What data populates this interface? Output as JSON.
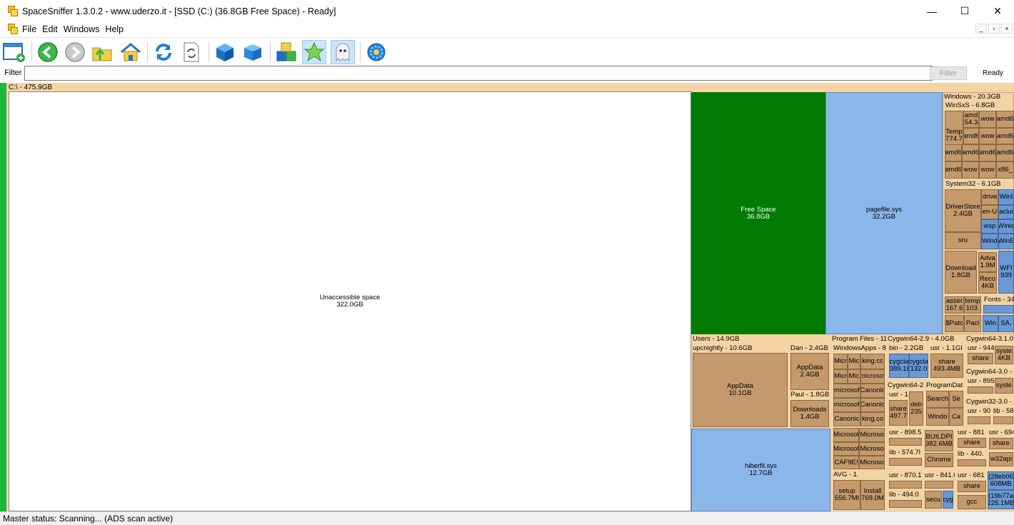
{
  "window": {
    "title": "SpaceSniffer 1.3.0.2 - www.uderzo.it - [SSD (C:) (36.8GB Free Space) - Ready]",
    "minimize": "—",
    "maximize": "☐",
    "close": "✕"
  },
  "menu": {
    "file": "File",
    "edit": "Edit",
    "windows": "Windows",
    "help": "Help",
    "mdi_min": "_",
    "mdi_restore": "▫",
    "mdi_close": "×"
  },
  "toolbar": {
    "icons": [
      "new-scan-icon",
      "back-icon",
      "forward-icon",
      "up-folder-icon",
      "home-icon",
      "refresh-icon",
      "refresh-page-icon",
      "blue-cube-icon",
      "blue-cube-flat-icon",
      "colored-cubes-icon",
      "star-icon",
      "ghost-icon",
      "gear-icon"
    ],
    "colors": {
      "green": "#3cb84a",
      "gray": "#9aa0a6",
      "blue": "#1f7fd6",
      "yellow": "#f0c020"
    }
  },
  "filter": {
    "label": "Filter",
    "value": "",
    "button": "Filter",
    "status": "Ready"
  },
  "treemap": {
    "root_label": "C:\\ - 475.9GB",
    "unaccessible": {
      "name": "Unaccessible space",
      "size": "322.0GB"
    },
    "free_space": {
      "name": "Free Space",
      "size": "36.8GB"
    },
    "pagefile": {
      "name": "pagefile.sys",
      "size": "32.2GB"
    },
    "hiberfil": {
      "name": "hiberfil.sys",
      "size": "12.7GB"
    },
    "windows": {
      "label": "Windows - 20.3GB",
      "winsxs": "WinSxS - 6.8GB",
      "temp": "Temp",
      "temp_size": "774.7",
      "amd1": "amd",
      "amd1_size": "54.3",
      "wow": "wow",
      "amd": "amd6",
      "x86": "x86_",
      "system32": "System32 - 6.1GB",
      "driverstore": "DriverStore",
      "driverstore_size": "2.4GB",
      "drive": "drive",
      "enu": "en-U",
      "wsp": "wsp",
      "wind": "Wind",
      "sru": "sru",
      "winr": "Winl",
      "acl": "aclui",
      "winl2": "Winla",
      "wine": "WinE",
      "download": "Download",
      "download_size": "1.8GB",
      "adva": "Adva",
      "adva_size": "1.9M",
      "reco": "Reco",
      "reco_size": "4KB",
      "wfi": "WFI",
      "wfi_size": "939",
      "asse": "asser",
      "asse_size": "167.6",
      "temp2": "temp",
      "temp2_size": "103.",
      "fonts": "Fonts - 34",
      "patc": "$Patc",
      "pack": "Pacl",
      "win": "Win",
      "sa": "SA."
    },
    "users": {
      "label": "Users - 14.9GB",
      "upcnightly": "upcnightly - 10.6GB",
      "appdata": "AppData",
      "appdata_size": "10.1GB",
      "dan": "Dan - 2.4GB",
      "dan_appdata": "AppData",
      "dan_appdata_size": "2.4GB",
      "paul": "Paul - 1.8GB",
      "downloads": "Downloads",
      "downloads_size": "1.4GB"
    },
    "program_files": {
      "label": "Program Files - 11",
      "windowsapps": "WindowsApps - 8",
      "mic1": "Micr",
      "mic2": "Mic",
      "king1": "king.cc",
      "microsof": "microsof",
      "canoni": "Canonic",
      "canoni2": "Canonic",
      "canoni3": "Canonic",
      "king2": "king.co",
      "microsof2": "Microsof",
      "microso3": "Microso",
      "caf": "CAF9E!",
      "avg": "AVG - 1.",
      "setup": "setup",
      "setup_size": "556.7MI",
      "install": "Install",
      "install_size": "769.0M"
    },
    "cygwin": {
      "cyg29": "Cygwin64-2.9 - 4.0GB",
      "bin": "bin - 2.2GB",
      "cygcla1": "cygcla",
      "cygcla1_size": "389.1I",
      "cygcla2": "cygcla",
      "cygcla2_size": "132.0",
      "usr_11": "usr - 1.1GI",
      "share_493": "share",
      "share_493_size": "493.4MB",
      "cyg2x": "Cygwin64-2",
      "usr_1": "usr - 1",
      "share_497": "share",
      "share_497_size": "497.7",
      "deb": "deb",
      "deb_size": "235",
      "programdat": "ProgramDat",
      "search": "Search",
      "se": "Se",
      "windo": "Windo",
      "ca": "Ca",
      "usr_898": "usr - 898.5",
      "lib_574": "lib - 574.7l",
      "buildp": "BUILDPI",
      "buildp_size": "382.6MB",
      "chrome": "Chrome",
      "usr_870": "usr - 870.1",
      "lib_494": "lib - 494.0",
      "usr_841": "usr - 841.6",
      "secu": "secu",
      "cyg": "cyg",
      "cyg31": "Cygwin64-3.1.0",
      "usr_944": "usr - 944.",
      "syste1": "syste",
      "syste1_size": "4KB",
      "share_1": "share",
      "cyg30": "Cygwin64-3.0 -",
      "usr_895": "usr - 895",
      "syste2": "syste",
      "cyg32": "Cygwin32-3.0 -",
      "usr_90": "usr - 90",
      "lib_586": "lib - 586",
      "usr_881": "usr - 881",
      "usr_694": "usr - 694",
      "share_2": "share",
      "share_3": "share",
      "lib_440": "lib - 440.",
      "w32api": "w32api",
      "usr_681": "usr - 681",
      "guid1": "{28eb06",
      "guid1_size": "608MB",
      "share_4": "share",
      "guid2": "{19b77a",
      "guid2_size": "225.1MB",
      "gcc": "gcc"
    }
  },
  "status": {
    "text": "Master status: Scanning... (ADS scan active)"
  }
}
